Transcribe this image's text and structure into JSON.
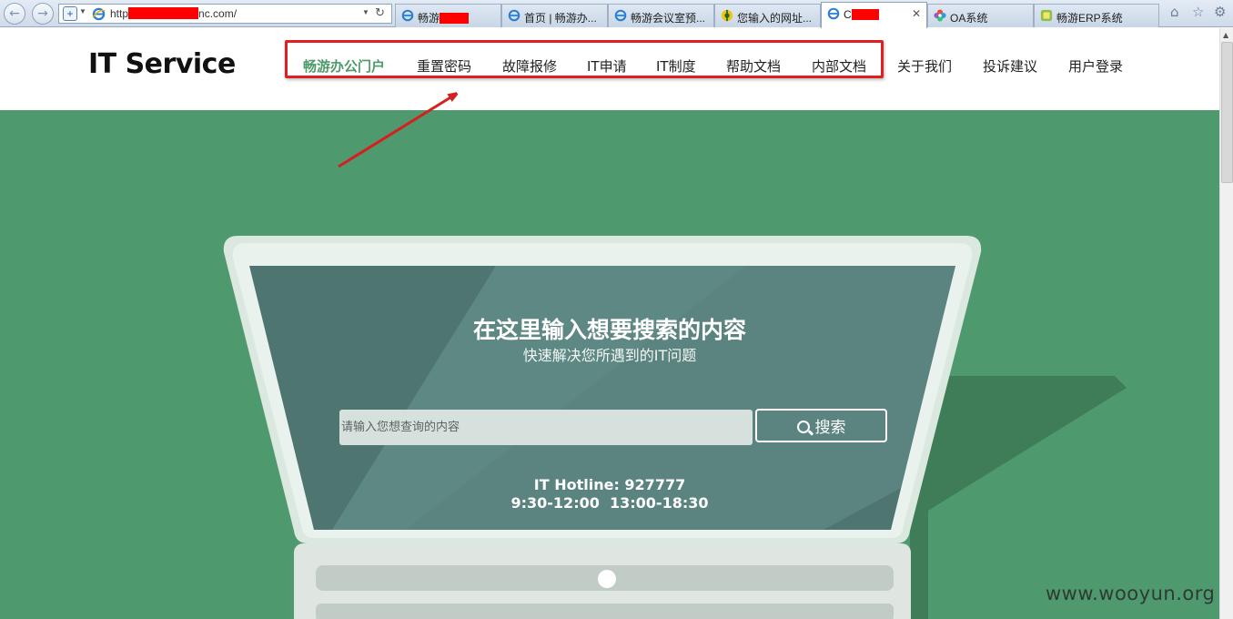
{
  "browser": {
    "url_prefix": "http",
    "url_suffix": "nc.com/",
    "tabs": [
      {
        "label": "畅游",
        "icon": "ie-icon",
        "redacted": true
      },
      {
        "label": "首页 | 畅游办...",
        "icon": "ie-icon"
      },
      {
        "label": "畅游会议室预...",
        "icon": "ie-icon"
      },
      {
        "label": "您输入的网址...",
        "icon": "warning-icon"
      },
      {
        "label": "C",
        "icon": "ie-icon",
        "redacted": true,
        "active": true
      },
      {
        "label": "OA系统",
        "icon": "flower-icon"
      },
      {
        "label": "畅游ERP系统",
        "icon": "erp-icon"
      }
    ]
  },
  "site": {
    "logo": "IT Service",
    "nav": [
      {
        "label": "畅游办公门户",
        "active": true
      },
      {
        "label": "重置密码"
      },
      {
        "label": "故障报修"
      },
      {
        "label": "IT申请"
      },
      {
        "label": "IT制度"
      },
      {
        "label": "帮助文档"
      },
      {
        "label": "内部文档"
      },
      {
        "label": "关于我们"
      },
      {
        "label": "投诉建议"
      },
      {
        "label": "用户登录"
      }
    ]
  },
  "hero": {
    "title": "在这里输入想要搜索的内容",
    "subtitle": "快速解决您所遇到的IT问题",
    "search_placeholder": "请输入您想查询的内容",
    "search_button": "搜索",
    "hotline": "IT Hotline: 927777",
    "hours": "9:30-12:00  13:00-18:30"
  },
  "watermark": "www.wooyun.org",
  "colors": {
    "brand_green": "#4e9a6a",
    "hero_bg": "#4e9a6e",
    "screen": "#4f7571",
    "annotation_red": "#e02020"
  }
}
